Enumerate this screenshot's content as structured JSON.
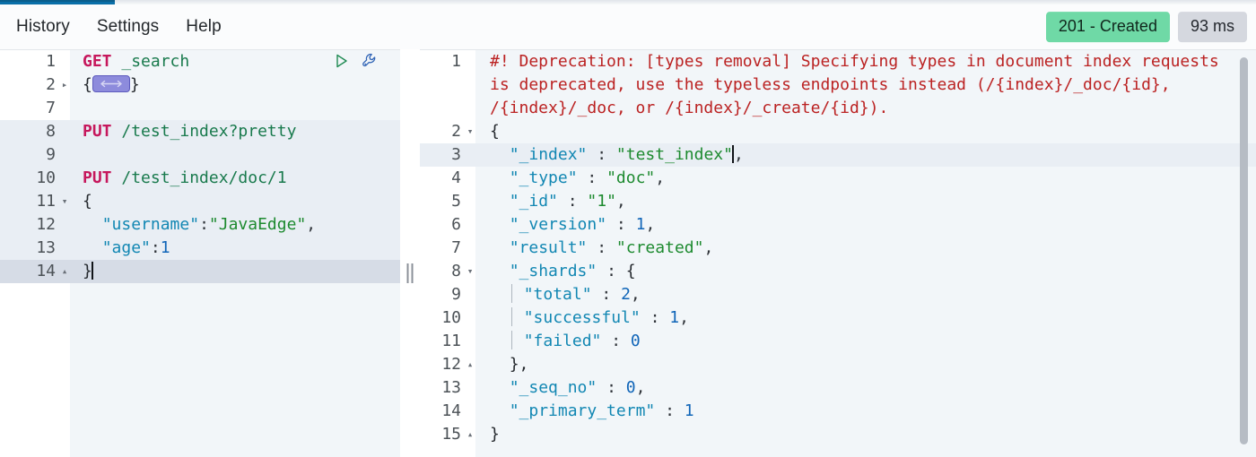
{
  "window": {
    "tab_indicator_color": "#0a6fa8"
  },
  "menubar": {
    "items": [
      {
        "label": "History",
        "name": "menu-history"
      },
      {
        "label": "Settings",
        "name": "menu-settings"
      },
      {
        "label": "Help",
        "name": "menu-help"
      }
    ],
    "status_badge": {
      "label": "201 - Created",
      "color": "#6fd9a6"
    },
    "time_badge": {
      "label": "93 ms",
      "color": "#d5d8df"
    }
  },
  "request_pane": {
    "lines": [
      {
        "num": "1",
        "fold": "",
        "state": ""
      },
      {
        "num": "2",
        "fold": "▸",
        "state": ""
      },
      {
        "num": "7",
        "fold": "",
        "state": ""
      },
      {
        "num": "8",
        "fold": "",
        "state": "hl"
      },
      {
        "num": "9",
        "fold": "",
        "state": "hl"
      },
      {
        "num": "10",
        "fold": "",
        "state": "hl"
      },
      {
        "num": "11",
        "fold": "▾",
        "state": "hl"
      },
      {
        "num": "12",
        "fold": "",
        "state": "hl"
      },
      {
        "num": "13",
        "fold": "",
        "state": "hl"
      },
      {
        "num": "14",
        "fold": "▴",
        "state": "active"
      }
    ],
    "line1_method": "GET",
    "line1_url": "_search",
    "line2_open": "{",
    "line2_close": "}",
    "line8_method": "PUT",
    "line8_url": "/test_index?pretty",
    "line10_method": "PUT",
    "line10_url": "/test_index/doc/1",
    "line11_brace": "{",
    "line12_key": "\"username\"",
    "line12_colon": ":",
    "line12_value": "\"JavaEdge\"",
    "line12_comma": ",",
    "line13_key": "\"age\"",
    "line13_colon": ":",
    "line13_value": "1",
    "line14_brace": "}",
    "actions": {
      "run_label": "run-request",
      "wrench_label": "copy-as-curl"
    }
  },
  "response_pane": {
    "lines": [
      {
        "num": "1",
        "fold": "",
        "state": ""
      },
      {
        "num": "2",
        "fold": "▾",
        "state": ""
      },
      {
        "num": "3",
        "fold": "",
        "state": "hl"
      },
      {
        "num": "4",
        "fold": "",
        "state": ""
      },
      {
        "num": "5",
        "fold": "",
        "state": ""
      },
      {
        "num": "6",
        "fold": "",
        "state": ""
      },
      {
        "num": "7",
        "fold": "",
        "state": ""
      },
      {
        "num": "8",
        "fold": "▾",
        "state": ""
      },
      {
        "num": "9",
        "fold": "",
        "state": ""
      },
      {
        "num": "10",
        "fold": "",
        "state": ""
      },
      {
        "num": "11",
        "fold": "",
        "state": ""
      },
      {
        "num": "12",
        "fold": "▴",
        "state": ""
      },
      {
        "num": "13",
        "fold": "",
        "state": ""
      },
      {
        "num": "14",
        "fold": "",
        "state": ""
      },
      {
        "num": "15",
        "fold": "▴",
        "state": ""
      }
    ],
    "warning": "#! Deprecation: [types removal] Specifying types in document index requests is deprecated, use the typeless endpoints instead (/{index}/_doc/{id}, /{index}/_doc, or /{index}/_create/{id}).",
    "open_brace": "{",
    "close_brace": "}",
    "fields": {
      "index_key": "\"_index\"",
      "index_value": "\"test_index\"",
      "type_key": "\"_type\"",
      "type_value": "\"doc\"",
      "id_key": "\"_id\"",
      "id_value": "\"1\"",
      "version_key": "\"_version\"",
      "version_value": "1",
      "result_key": "\"result\"",
      "result_value": "\"created\"",
      "shards_key": "\"_shards\"",
      "shards_open": "{",
      "total_key": "\"total\"",
      "total_value": "2",
      "successful_key": "\"successful\"",
      "successful_value": "1",
      "failed_key": "\"failed\"",
      "failed_value": "0",
      "shards_close": "},",
      "seq_no_key": "\"_seq_no\"",
      "seq_no_value": "0",
      "primary_term_key": "\"_primary_term\"",
      "primary_term_value": "1"
    },
    "colon": ":",
    "comma": ","
  }
}
